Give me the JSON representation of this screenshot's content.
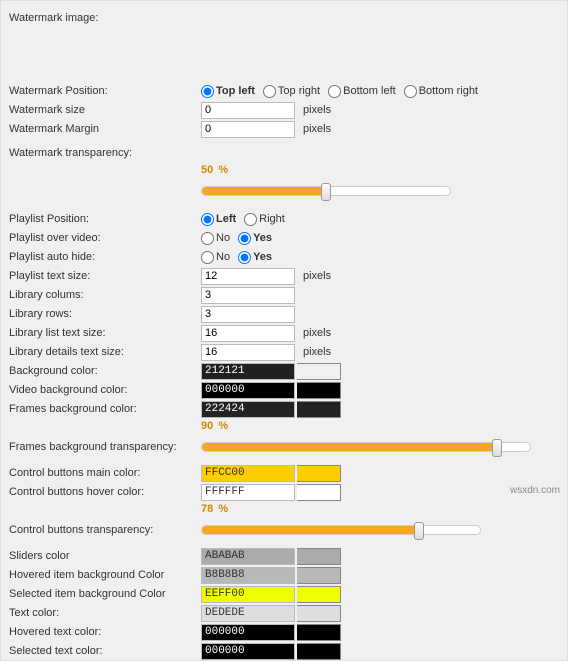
{
  "labels": {
    "watermark_image": "Watermark image:",
    "watermark_position": "Watermark Position:",
    "watermark_size": "Watermark size",
    "watermark_margin": "Watermark Margin",
    "watermark_transparency": "Watermark transparency:",
    "playlist_position": "Playlist Position:",
    "playlist_over_video": "Playlist over video:",
    "playlist_auto_hide": "Playlist auto hide:",
    "playlist_text_size": "Playlist text size:",
    "library_columns": "Library colums:",
    "library_rows": "Library rows:",
    "library_list_text_size": "Library list text size:",
    "library_details_text_size": "Library details text size:",
    "background_color": "Background color:",
    "video_background_color": "Video background color:",
    "frames_background_color": "Frames background color:",
    "frames_background_transparency": "Frames background transparency:",
    "control_buttons_main_color": "Control buttons main color:",
    "control_buttons_hover_color": "Control buttons hover color:",
    "control_buttons_transparency": "Control buttons transparency:",
    "sliders_color": "Sliders color",
    "hovered_item_bg": "Hovered item background Color",
    "selected_item_bg": "Selected item background Color",
    "text_color": "Text color:",
    "hovered_text_color": "Hovered text color:",
    "selected_text_color": "Selected text color:"
  },
  "options": {
    "top_left": "Top left",
    "top_right": "Top right",
    "bottom_left": "Bottom left",
    "bottom_right": "Bottom right",
    "left": "Left",
    "right": "Right",
    "no": "No",
    "yes": "Yes"
  },
  "values": {
    "watermark_size": "0",
    "watermark_margin": "0",
    "watermark_transparency": "50",
    "playlist_text_size": "12",
    "library_columns": "3",
    "library_rows": "3",
    "library_list_text_size": "16",
    "library_details_text_size": "16",
    "background_color": "212121",
    "video_background_color": "000000",
    "frames_background_color": "222424",
    "frames_transparency": "90",
    "control_main_color": "FFCC00",
    "control_hover_color": "FFFFFF",
    "control_transparency": "78",
    "sliders_color": "ABABAB",
    "hovered_item_bg": "B8B8B8",
    "selected_item_bg": "EEFF00",
    "text_color": "DEDEDE",
    "hovered_text_color": "000000",
    "selected_text_color": "000000"
  },
  "units": {
    "pixels": "pixels",
    "percent": "%"
  },
  "swatches": {
    "background_color": "#212121",
    "video_background_color": "#000000",
    "frames_background_color": "#222424",
    "control_main_color": "#FFCC00",
    "control_hover_color": "#FFFFFF",
    "sliders_color": "#ABABAB",
    "hovered_item_bg": "#B8B8B8",
    "selected_item_bg": "#EEFF00",
    "text_color": "#DEDEDE",
    "hovered_text_color": "#000000",
    "selected_text_color": "#000000"
  },
  "footer": "wsxdn.com"
}
